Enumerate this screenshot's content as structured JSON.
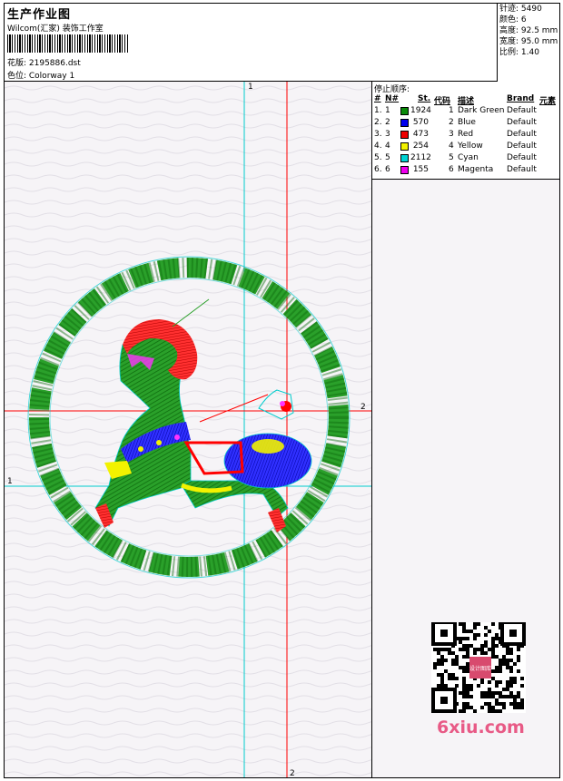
{
  "header": {
    "title": "生产作业图",
    "company": "Wilcom(汇家) 装饰工作室",
    "design_label": "花版: 2195886.dst",
    "colorway_label": "色位: Colorway 1"
  },
  "specs": {
    "stitches": "针迹: 5490",
    "colors": "颜色: 6",
    "height": "高度: 92.5 mm",
    "width": "宽度: 95.0 mm",
    "scale": "比例: 1.40"
  },
  "stop_sequence": {
    "title": "停止顺序:",
    "headers": {
      "num": "#",
      "n": "N#",
      "st": "St.",
      "code": "代码",
      "desc": "描述",
      "brand": "Brand",
      "elem": "元素"
    },
    "rows": [
      {
        "num": "1.",
        "n": "1",
        "st": "1924",
        "code": "1",
        "desc": "Dark Green",
        "brand": "Default",
        "color": "#0a8a0a"
      },
      {
        "num": "2.",
        "n": "2",
        "st": "570",
        "code": "2",
        "desc": "Blue",
        "brand": "Default",
        "color": "#0000ee"
      },
      {
        "num": "3.",
        "n": "3",
        "st": "473",
        "code": "3",
        "desc": "Red",
        "brand": "Default",
        "color": "#ee0000"
      },
      {
        "num": "4.",
        "n": "4",
        "st": "254",
        "code": "4",
        "desc": "Yellow",
        "brand": "Default",
        "color": "#f2f200"
      },
      {
        "num": "5.",
        "n": "5",
        "st": "2112",
        "code": "5",
        "desc": "Cyan",
        "brand": "Default",
        "color": "#00d4d4"
      },
      {
        "num": "6.",
        "n": "6",
        "st": "155",
        "code": "6",
        "desc": "Magenta",
        "brand": "Default",
        "color": "#ee00ee"
      }
    ]
  },
  "axes": {
    "v_cyan": "1",
    "v_red": "2",
    "h_red": "2",
    "h_cyan": "1"
  },
  "watermark": {
    "brand": "6xiu.com",
    "seal": "设计图库"
  }
}
